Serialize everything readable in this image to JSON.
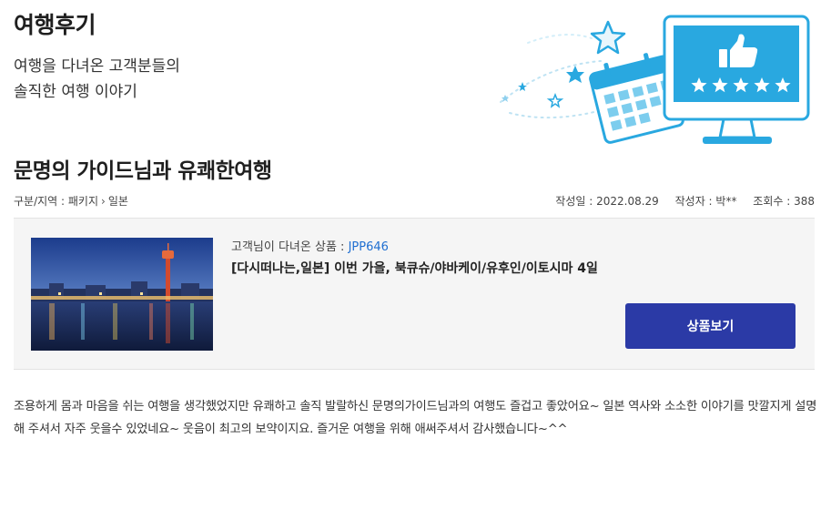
{
  "hero": {
    "title": "여행후기",
    "subtitle_line1": "여행을 다녀온 고객분들의",
    "subtitle_line2": "솔직한 여행 이야기"
  },
  "post": {
    "title": "문명의 가이드님과 유쾌한여행",
    "category_label": "구분/지역 : 패키지",
    "category_region": "일본",
    "date": "작성일 : 2022.08.29",
    "author": "작성자 : 박**",
    "views": "조회수 : 388"
  },
  "product": {
    "label": "고객님이 다녀온 상품 :",
    "code": "JPP646",
    "name": "[다시떠나는,일본] 이번 가을, 북큐슈/야바케이/유후인/이토시마 4일",
    "view_button": "상품보기",
    "thumbnail": "harbor-night-tower-photo"
  },
  "review": {
    "text": " 조용하게 몸과 마음을 쉬는 여행을 생각했었지만 유쾌하고 솔직 발랄하신 문명의가이드님과의 여행도 즐겁고 좋았어요~ 일본 역사와 소소한 이야기를 맛깔지게 설명해 주셔서 자주 웃을수 있었네요~ 웃음이 최고의 보약이지요. 즐거운 여행을 위해 애써주셔서 감사했습니다~^^"
  },
  "colors": {
    "accent_blue": "#1f6fd1",
    "button_navy": "#2b3aa6",
    "illustration_blue": "#29a8e0",
    "box_bg": "#f5f5f5"
  },
  "icons": [
    "star-icon",
    "calendar-icon",
    "thumbs-up-icon",
    "monitor-icon",
    "chevron-right-icon"
  ]
}
